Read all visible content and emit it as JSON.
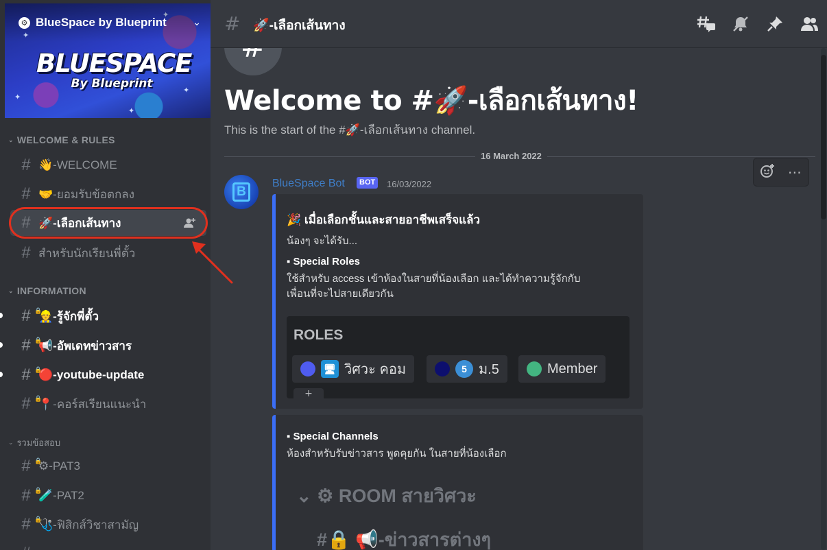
{
  "server": {
    "name": "BlueSpace by Blueprint",
    "banner_title": "BLUESPACE",
    "banner_subtitle": "By Blueprint"
  },
  "sidebar": {
    "categories": [
      {
        "label": "WELCOME & RULES"
      },
      {
        "label": "INFORMATION"
      },
      {
        "label": "รวมข้อสอบ"
      }
    ],
    "channels": [
      {
        "emoji": "👋",
        "label": "-WELCOME"
      },
      {
        "emoji": "🤝",
        "label": "-ยอมรับข้อตกลง"
      },
      {
        "emoji": "🚀",
        "label": "-เลือกเส้นทาง"
      },
      {
        "emoji": "",
        "label": "สำหรับนักเรียนพี่ตั้ว"
      },
      {
        "emoji": "👷",
        "label": "-รู้จักพี่ตั้ว"
      },
      {
        "emoji": "📢",
        "label": "-อัพเดทข่าวสาร"
      },
      {
        "emoji": "🔴",
        "label": "-youtube-update"
      },
      {
        "emoji": "📍",
        "label": "-คอร์สเรียนแนะนำ"
      },
      {
        "emoji": "⚙",
        "label": "-PAT3"
      },
      {
        "emoji": "🧪",
        "label": "-PAT2"
      },
      {
        "emoji": "🩺",
        "label": "-ฟิสิกส์วิชาสามัญ"
      }
    ]
  },
  "header": {
    "channel_emoji": "🚀",
    "channel_name": "-เลือกเส้นทาง"
  },
  "main": {
    "welcome_title": "Welcome to #🚀-เลือกเส้นทาง!",
    "welcome_subtitle": "This is the start of the #🚀-เลือกเส้นทาง channel.",
    "date_divider": "16 March 2022",
    "message": {
      "author": "BlueSpace Bot",
      "bot_tag": "BOT",
      "timestamp": "16/03/2022",
      "avatar_letter": "B",
      "embed1": {
        "title": "🎉 เมื่อเลือกชั้นและสายอาชีพเสร็จแล้ว",
        "intro": "น้องๆ จะได้รับ...",
        "section_title": "▪ Special Roles",
        "section_line1": "ใช้สำหรับ access เข้าห้องในสายที่น้องเลือก และได้ทำความรู้จักกับ",
        "section_line2": "เพื่อนที่จะไปสายเดียวกัน",
        "roles_header": "ROLES",
        "roles": [
          {
            "emoji": "🖥",
            "label": "วิศวะ คอม",
            "color": "#4f5cf0"
          },
          {
            "emoji": "5",
            "label": "ม.5",
            "color": "#0d0f6e"
          },
          {
            "emoji": "",
            "label": "Member",
            "color": "#43b581"
          }
        ]
      },
      "embed2": {
        "section_title": "▪ Special Channels",
        "section_line1": "ห้องสำหรับรับข่าวสาร พูดคุยกัน ในสายที่น้องเลือก",
        "room_title": "⌄ ⚙ ROOM สายวิศวะ",
        "room_channel": "#🔒 📢-ข่าวสารต่างๆ"
      }
    }
  },
  "colors": {
    "accent": "#5865f2",
    "embed_border": "#3b6ef6",
    "highlight": "#e0301e"
  }
}
